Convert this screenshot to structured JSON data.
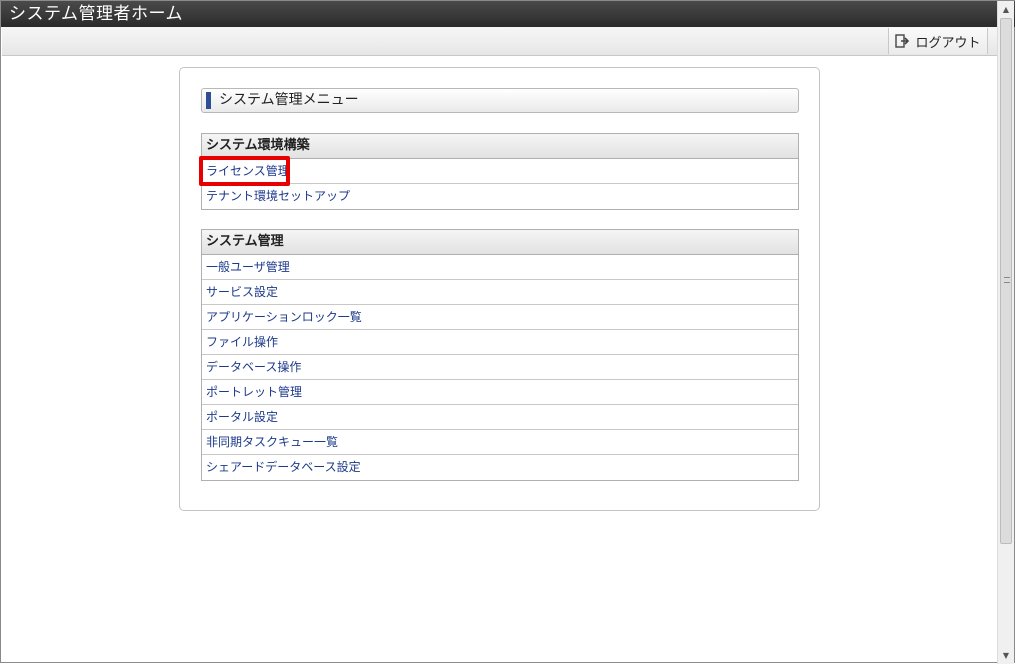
{
  "window": {
    "title": "システム管理者ホーム"
  },
  "toolbar": {
    "logout_label": "ログアウト"
  },
  "menu": {
    "header": "システム管理メニュー",
    "sections": [
      {
        "title": "システム環境構築",
        "items": [
          "ライセンス管理",
          "テナント環境セットアップ"
        ]
      },
      {
        "title": "システム管理",
        "items": [
          "一般ユーザ管理",
          "サービス設定",
          "アプリケーションロック一覧",
          "ファイル操作",
          "データベース操作",
          "ポートレット管理",
          "ポータル設定",
          "非同期タスクキュー一覧",
          "シェアードデータベース設定"
        ]
      }
    ]
  },
  "annotation": {
    "highlighted_item": "ライセンス管理",
    "highlight_color": "#e60000"
  }
}
